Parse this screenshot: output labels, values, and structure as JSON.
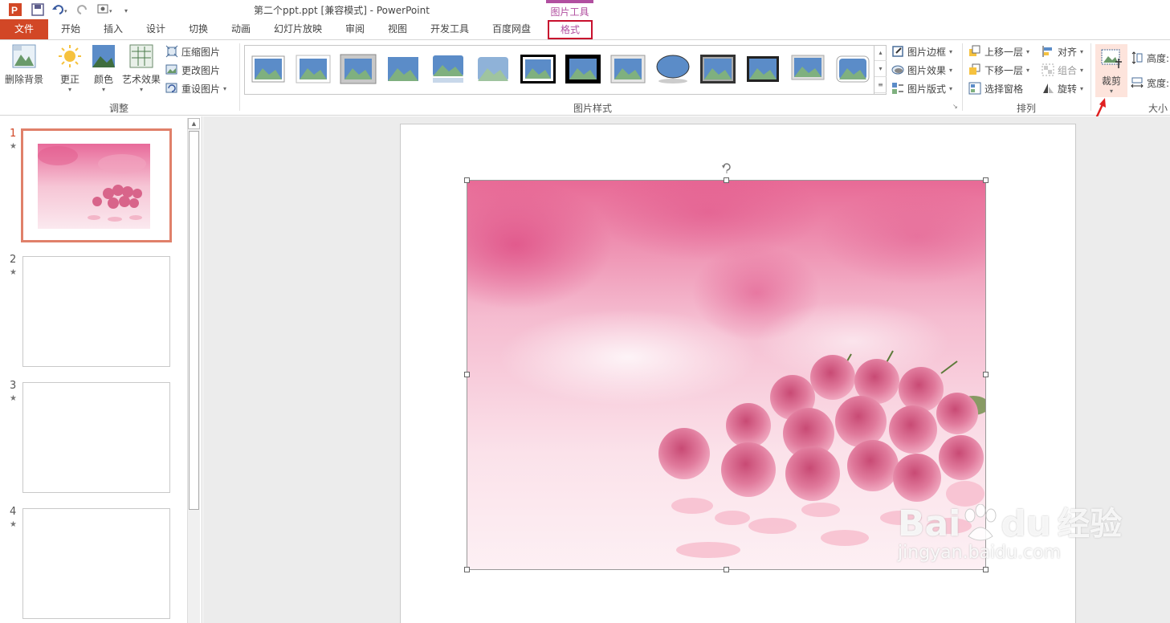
{
  "window": {
    "title": "第二个ppt.ppt [兼容模式] - PowerPoint",
    "context_tools_label": "图片工具"
  },
  "tabs": [
    {
      "label": "文件"
    },
    {
      "label": "开始"
    },
    {
      "label": "插入"
    },
    {
      "label": "设计"
    },
    {
      "label": "切换"
    },
    {
      "label": "动画"
    },
    {
      "label": "幻灯片放映"
    },
    {
      "label": "审阅"
    },
    {
      "label": "视图"
    },
    {
      "label": "开发工具"
    },
    {
      "label": "百度网盘"
    },
    {
      "label": "格式"
    }
  ],
  "ribbon": {
    "adjust": {
      "remove_bg": "删除背景",
      "corrections": "更正",
      "color": "颜色",
      "artistic": "艺术效果",
      "compress": "压缩图片",
      "change": "更改图片",
      "reset": "重设图片",
      "group_label": "调整"
    },
    "styles": {
      "border": "图片边框",
      "effects": "图片效果",
      "layout": "图片版式",
      "group_label": "图片样式"
    },
    "arrange": {
      "bring_forward": "上移一层",
      "send_backward": "下移一层",
      "selection_pane": "选择窗格",
      "align": "对齐",
      "group": "组合",
      "rotate": "旋转",
      "group_label": "排列"
    },
    "size": {
      "crop": "裁剪",
      "height": "高度:",
      "width": "宽度:",
      "group_label": "大小"
    }
  },
  "slides": [
    {
      "num": "1",
      "star": "★"
    },
    {
      "num": "2",
      "star": "★"
    },
    {
      "num": "3",
      "star": "★"
    },
    {
      "num": "4",
      "star": "★"
    }
  ],
  "watermark": {
    "brand": "Bai",
    "brand2": "du",
    "cn": "经验",
    "url": "jingyan.baidu.com"
  },
  "colors": {
    "accent": "#d24726",
    "context": "#b14fa0",
    "highlight": "#c8102e"
  }
}
